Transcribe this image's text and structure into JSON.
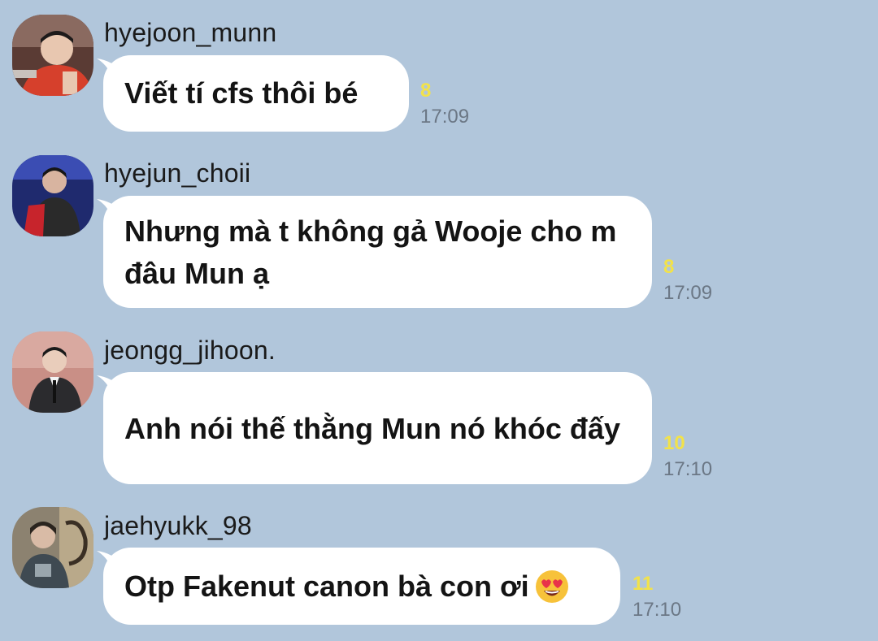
{
  "messages": [
    {
      "username": "hyejoon_munn",
      "text": "Viết tí cfs thôi bé",
      "unread": "8",
      "time": "17:09"
    },
    {
      "username": "hyejun_choii",
      "text": "Nhưng mà t không gả Wooje cho m đâu Mun ạ",
      "unread": "8",
      "time": "17:09"
    },
    {
      "username": "jeongg_jihoon.",
      "text": "Anh nói thế thằng Mun nó khóc đấy",
      "unread": "10",
      "time": "17:10"
    },
    {
      "username": "jaehyukk_98",
      "text": "Otp Fakenut canon bà con ơi",
      "unread": "11",
      "time": "17:10",
      "emoji": "heart-eyes-emoji"
    }
  ],
  "colors": {
    "background": "#b1c6db",
    "bubble": "#ffffff",
    "unread_count": "#f2e24a",
    "timestamp": "#6b7785"
  }
}
